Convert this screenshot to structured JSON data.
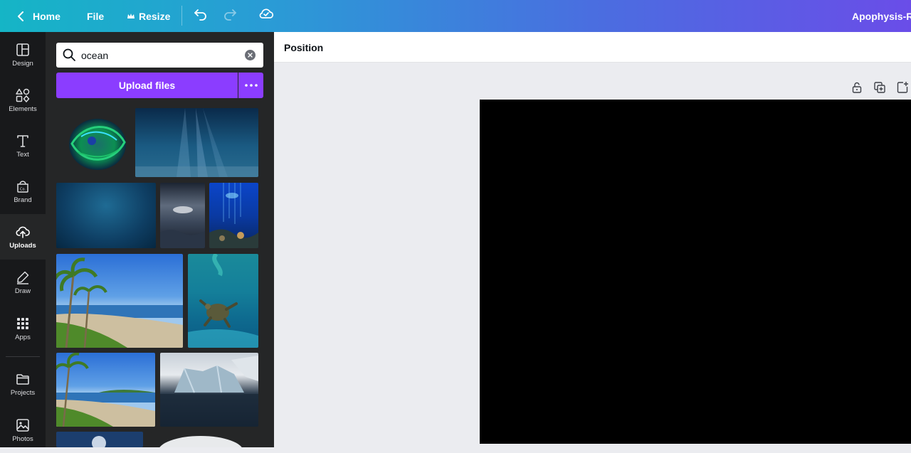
{
  "topbar": {
    "home_label": "Home",
    "file_label": "File",
    "resize_label": "Resize",
    "design_title": "Apophysis-Re",
    "icons": [
      "chevron-left-icon",
      "crown-icon",
      "undo-icon",
      "redo-icon",
      "cloud-check-icon"
    ]
  },
  "rail": {
    "items": [
      {
        "label": "Design",
        "icon": "layout-icon"
      },
      {
        "label": "Elements",
        "icon": "shapes-icon"
      },
      {
        "label": "Text",
        "icon": "text-icon"
      },
      {
        "label": "Brand",
        "icon": "brand-kit-icon"
      },
      {
        "label": "Uploads",
        "icon": "cloud-upload-icon",
        "active": true
      },
      {
        "label": "Draw",
        "icon": "pen-icon"
      },
      {
        "label": "Apps",
        "icon": "grid-icon"
      },
      {
        "label": "Projects",
        "icon": "folder-icon"
      },
      {
        "label": "Photos",
        "icon": "image-icon"
      }
    ]
  },
  "panel": {
    "search": {
      "value": "ocean",
      "placeholder": "Search"
    },
    "upload_label": "Upload files",
    "thumbnails": [
      "green fractal fish",
      "underwater light rays",
      "deep blue water",
      "storm over sea",
      "underwater scene with jellyfish",
      "palm tree beach",
      "sea turtle underwater",
      "palm tree beach small",
      "iceberg",
      "moon",
      "white shape"
    ]
  },
  "context_bar": {
    "position_label": "Position"
  },
  "colors": {
    "accent": "#8b3dff",
    "rail_bg": "#18191b",
    "panel_bg": "#252627",
    "canvas_bg": "#ebecf0",
    "page_bg": "#000000"
  }
}
